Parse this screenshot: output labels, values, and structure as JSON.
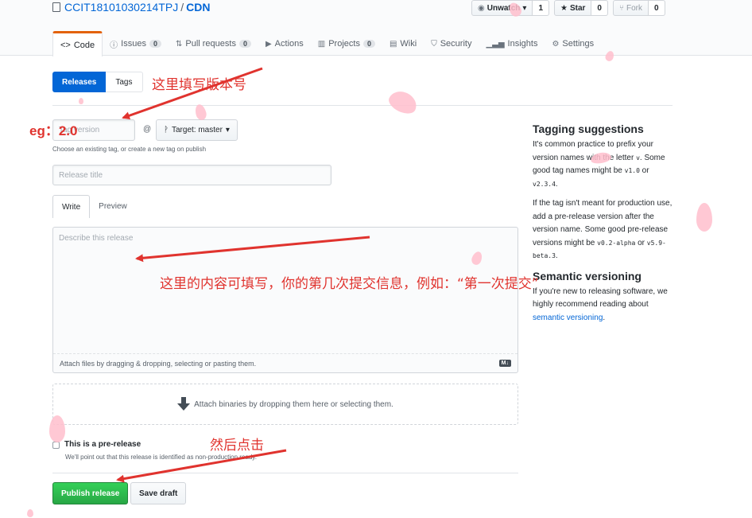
{
  "repo": {
    "owner": "CCIT18101030214TPJ",
    "separator": "/",
    "name": "CDN"
  },
  "repo_actions": {
    "watch": {
      "label": "Unwatch",
      "count": "1"
    },
    "star": {
      "label": "Star",
      "count": "0"
    },
    "fork": {
      "label": "Fork",
      "count": "0"
    }
  },
  "tabs": [
    {
      "label": "Code",
      "icon": "code-icon",
      "count": ""
    },
    {
      "label": "Issues",
      "icon": "issue-icon",
      "count": "0"
    },
    {
      "label": "Pull requests",
      "icon": "pull-request-icon",
      "count": "0"
    },
    {
      "label": "Actions",
      "icon": "play-icon",
      "count": ""
    },
    {
      "label": "Projects",
      "icon": "project-icon",
      "count": "0"
    },
    {
      "label": "Wiki",
      "icon": "book-icon",
      "count": ""
    },
    {
      "label": "Security",
      "icon": "shield-icon",
      "count": ""
    },
    {
      "label": "Insights",
      "icon": "graph-icon",
      "count": ""
    },
    {
      "label": "Settings",
      "icon": "gear-icon",
      "count": ""
    }
  ],
  "segment": {
    "releases": "Releases",
    "tags": "Tags"
  },
  "form": {
    "tag_placeholder": "Tag version",
    "at_symbol": "@",
    "target_label": "Target: master",
    "tag_hint": "Choose an existing tag, or create a new tag on publish",
    "title_placeholder": "Release title",
    "write_tab": "Write",
    "preview_tab": "Preview",
    "body_placeholder": "Describe this release",
    "attach_hint": "Attach files by dragging & dropping, selecting or pasting them.",
    "markdown_badge": "M↓",
    "binaries_hint": "Attach binaries by dropping them here or selecting them.",
    "prerelease_label": "This is a pre-release",
    "prerelease_note": "We'll point out that this release is identified as non-production ready.",
    "publish_label": "Publish release",
    "draft_label": "Save draft"
  },
  "sidebar": {
    "tagging_title": "Tagging suggestions",
    "tagging_p1_a": "It's common practice to prefix your version names with the letter ",
    "tagging_p1_code1": "v",
    "tagging_p1_b": ". Some good tag names might be ",
    "tagging_p1_code2": "v1.0",
    "tagging_p1_c": " or ",
    "tagging_p1_code3": "v2.3.4",
    "tagging_p1_d": ".",
    "tagging_p2_a": "If the tag isn't meant for production use, add a pre-release version after the version name. Some good pre-release versions might be ",
    "tagging_p2_code1": "v0.2-alpha",
    "tagging_p2_b": " or ",
    "tagging_p2_code2": "v5.9-beta.3",
    "tagging_p2_c": ".",
    "semver_title": "Semantic versioning",
    "semver_p_a": "If you're new to releasing software, we highly recommend reading about ",
    "semver_link": "semantic versioning",
    "semver_p_b": "."
  },
  "annotations": {
    "version_hint": "这里填写版本号",
    "example": "eg：2.0",
    "content_hint": "这里的内容可填写，你的第几次提交信息，例如：“第一次提交”",
    "click_hint": "然后点击"
  },
  "colors": {
    "annotation": "#e0332e",
    "accent_orange": "#e36209",
    "primary_blue": "#0366d6",
    "publish_green": "#28a745"
  }
}
